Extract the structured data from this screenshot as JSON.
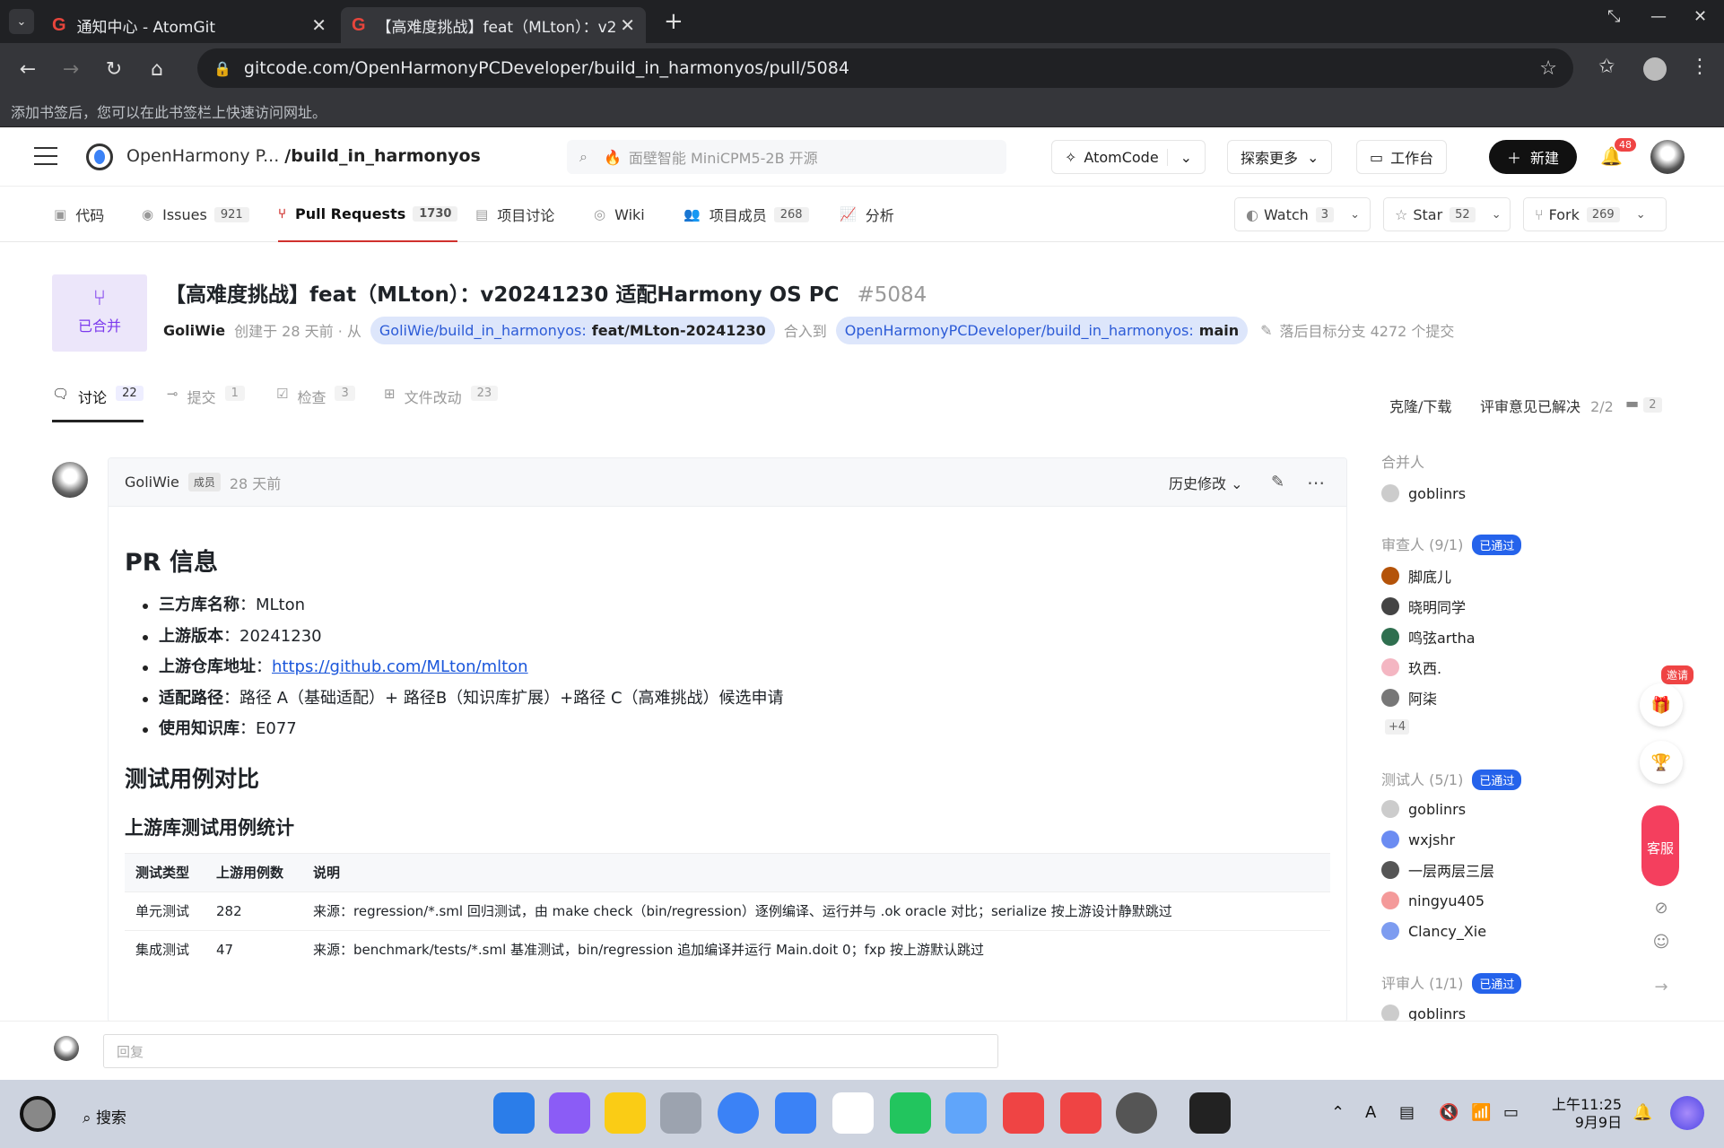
{
  "browser": {
    "tabs": [
      {
        "title": "通知中心 - AtomGit",
        "active": false
      },
      {
        "title": "【高难度挑战】feat（MLton）：v2",
        "active": true
      }
    ],
    "url": "gitcode.com/OpenHarmonyPCDeveloper/build_in_harmonyos/pull/5084",
    "bookmark_hint": "添加书签后，您可以在此书签栏上快速访问网址。"
  },
  "site": {
    "org": "OpenHarmony P...",
    "repo": "/build_in_harmonyos",
    "search_placeholder": "面壁智能 MiniCPM5-2B 开源",
    "atomcode": "AtomCode",
    "explore": "探索更多",
    "workbench": "工作台",
    "new_label": "新建",
    "notif_count": "48"
  },
  "repo_tabs": [
    {
      "label": "代码",
      "count": "",
      "icon": "code-icon"
    },
    {
      "label": "Issues",
      "count": "921",
      "icon": "issues-icon"
    },
    {
      "label": "Pull Requests",
      "count": "1730",
      "icon": "pr-icon"
    },
    {
      "label": "项目讨论",
      "count": "",
      "icon": "discussion-icon"
    },
    {
      "label": "Wiki",
      "count": "",
      "icon": "wiki-icon"
    },
    {
      "label": "项目成员",
      "count": "268",
      "icon": "members-icon"
    },
    {
      "label": "分析",
      "count": "",
      "icon": "analytics-icon"
    }
  ],
  "repo_actions": {
    "watch": {
      "label": "Watch",
      "count": "3"
    },
    "star": {
      "label": "Star",
      "count": "52"
    },
    "fork": {
      "label": "Fork",
      "count": "269"
    }
  },
  "pr": {
    "status": "已合并",
    "title": "【高难度挑战】feat（MLton）：v20241230 适配Harmony OS PC",
    "number": "#5084",
    "author": "GoliWie",
    "created": "创建于 28 天前 · 从",
    "source_repo": "GoliWie/build_in_harmonyos:",
    "source_branch": "feat/MLton-20241230",
    "merge_into": "合入到",
    "target_repo": "OpenHarmonyPCDeveloper/build_in_harmonyos:",
    "target_branch": "main",
    "behind": "落后目标分支 4272 个提交"
  },
  "pr_tabs": [
    {
      "label": "讨论",
      "count": "22"
    },
    {
      "label": "提交",
      "count": "1"
    },
    {
      "label": "检查",
      "count": "3"
    },
    {
      "label": "文件改动",
      "count": "23"
    }
  ],
  "pr_right": {
    "clone": "克隆/下载",
    "resolved": "评审意见已解决",
    "resolved_count": "2/2",
    "comment_count": "2"
  },
  "comment": {
    "author": "GoliWie",
    "role": "成员",
    "time": "28 天前",
    "history": "历史修改",
    "h1": "PR 信息",
    "items": [
      {
        "key": "三方库名称",
        "sep": "：",
        "value": "MLton"
      },
      {
        "key": "上游版本",
        "sep": "：",
        "value": "20241230"
      },
      {
        "key": "上游仓库地址",
        "sep": "：",
        "value": "https://github.com/MLton/mlton"
      },
      {
        "key": "适配路径",
        "sep": "：",
        "value": "路径 A（基础适配）+ 路径B（知识库扩展）+路径 C（高难挑战）候选申请"
      },
      {
        "key": "使用知识库",
        "sep": "：",
        "value": "E077"
      }
    ],
    "h2": "测试用例对比",
    "h3": "上游库测试用例统计",
    "table": {
      "headers": [
        "测试类型",
        "上游用例数",
        "说明"
      ],
      "rows": [
        {
          "type": "单元测试",
          "count": "282",
          "desc": "来源：regression/*.sml 回归测试，由 make check（bin/regression）逐例编译、运行并与 .ok oracle 对比；serialize 按上游设计静默跳过"
        },
        {
          "type": "集成测试",
          "count": "47",
          "desc": "来源：benchmark/tests/*.sml 基准测试，bin/regression 追加编译并运行 Main.doit 0；fxp 按上游默认跳过"
        }
      ]
    }
  },
  "sidebar": {
    "merger_title": "合并人",
    "merger": "goblinrs",
    "reviewers_title": "审查人 (9/1)",
    "passed": "已通过",
    "reviewers": [
      "脚底儿",
      "晓明同学",
      "鸣弦artha",
      "玖西.",
      "阿柒"
    ],
    "reviewers_more": "+4",
    "testers_title": "测试人 (5/1)",
    "testers": [
      "goblinrs",
      "wxjshr",
      "一层两层三层",
      "ningyu405",
      "Clancy_Xie"
    ],
    "raters_title": "评审人 (1/1)",
    "raters": [
      "goblinrs"
    ]
  },
  "float": {
    "invite": "邀请",
    "service": "客服"
  },
  "reply_placeholder": "回复",
  "taskbar": {
    "search": "搜索",
    "time": "上午11:25",
    "date": "9月9日"
  },
  "colors": {
    "accent": "#d0312d",
    "merged": "#7c3aed",
    "branch_bg": "#dde6fb",
    "pass_badge": "#2563eb"
  }
}
